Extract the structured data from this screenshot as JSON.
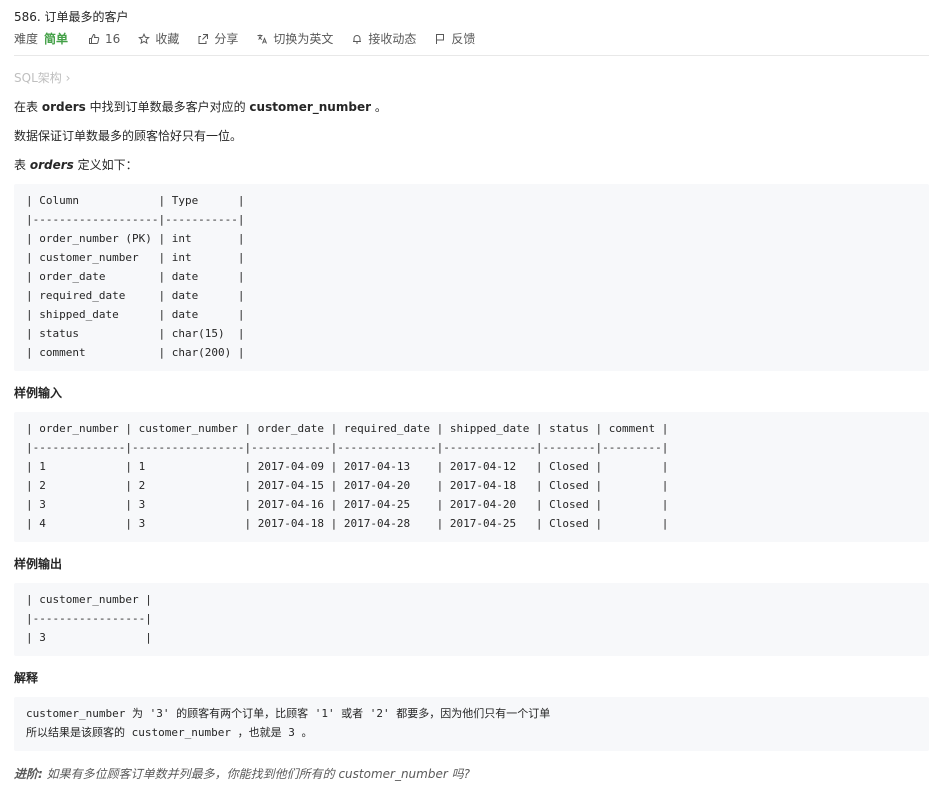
{
  "problem": {
    "title": "586. 订单最多的客户",
    "difficulty_label": "难度",
    "difficulty": "简单",
    "likes": "16",
    "favorite": "收藏",
    "share": "分享",
    "switch_lang": "切换为英文",
    "subscribe": "接收动态",
    "feedback": "反馈",
    "breadcrumb": "SQL架构 ›",
    "desc_prefix": "在表 ",
    "desc_table": "orders",
    "desc_mid": " 中找到订单数最多客户对应的 ",
    "desc_field": "customer_number",
    "desc_suffix": " 。",
    "guarantee": "数据保证订单数最多的顾客恰好只有一位。",
    "def_prefix": "表 ",
    "def_table": "orders",
    "def_suffix": " 定义如下："
  },
  "schema_block": "| Column            | Type      |\n|-------------------|-----------|\n| order_number (PK) | int       |\n| customer_number   | int       |\n| order_date        | date      |\n| required_date     | date      |\n| shipped_date      | date      |\n| status            | char(15)  |\n| comment           | char(200) |",
  "sample_input_heading": "样例输入",
  "sample_input_block": "| order_number | customer_number | order_date | required_date | shipped_date | status | comment |\n|--------------|-----------------|------------|---------------|--------------|--------|---------|\n| 1            | 1               | 2017-04-09 | 2017-04-13    | 2017-04-12   | Closed |         |\n| 2            | 2               | 2017-04-15 | 2017-04-20    | 2017-04-18   | Closed |         |\n| 3            | 3               | 2017-04-16 | 2017-04-25    | 2017-04-20   | Closed |         |\n| 4            | 3               | 2017-04-18 | 2017-04-28    | 2017-04-25   | Closed |         |",
  "sample_output_heading": "样例输出",
  "sample_output_block": "| customer_number |\n|-----------------|\n| 3               |",
  "explanation_heading": "解释",
  "explanation_block": "customer_number 为 '3' 的顾客有两个订单，比顾客 '1' 或者 '2' 都要多，因为他们只有一个订单\n所以结果是该顾客的 customer_number ，也就是 3 。",
  "advanced_label": "进阶:",
  "advanced_text": " 如果有多位顾客订单数并列最多，你能找到他们所有的 customer_number 吗?",
  "colors": {
    "difficulty_easy": "#43a047",
    "code_bg": "#f7f8fa",
    "muted": "#bfbfbf"
  },
  "icons": {
    "like": "thumb-up-icon",
    "favorite": "star-icon",
    "share": "share-icon",
    "translate": "translate-icon",
    "subscribe": "bell-icon",
    "feedback": "flag-icon"
  }
}
